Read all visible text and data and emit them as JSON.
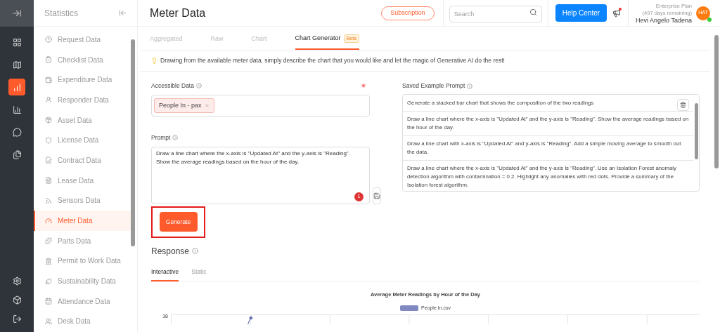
{
  "sidebar": {
    "title": "Statistics",
    "items": [
      {
        "label": "Request Data",
        "selected": false
      },
      {
        "label": "Checklist Data",
        "selected": false
      },
      {
        "label": "Expenditure Data",
        "selected": false
      },
      {
        "label": "Responder Data",
        "selected": false
      },
      {
        "label": "Asset Data",
        "selected": false
      },
      {
        "label": "License Data",
        "selected": false
      },
      {
        "label": "Contract Data",
        "selected": false
      },
      {
        "label": "Lease Data",
        "selected": false
      },
      {
        "label": "Sensors Data",
        "selected": false
      },
      {
        "label": "Meter Data",
        "selected": true
      },
      {
        "label": "Parts Data",
        "selected": false
      },
      {
        "label": "Permit to Work Data",
        "selected": false
      },
      {
        "label": "Sustainability Data",
        "selected": false
      },
      {
        "label": "Attendance Data",
        "selected": false
      },
      {
        "label": "Desk Data",
        "selected": false
      }
    ]
  },
  "rail": {
    "items": [
      {
        "selected": false
      },
      {
        "selected": false
      },
      {
        "selected": true
      },
      {
        "selected": false
      },
      {
        "selected": false
      },
      {
        "selected": false
      }
    ]
  },
  "header": {
    "title": "Meter Data",
    "subscription": "Subscription",
    "search_placeholder": "Search",
    "help": "Help Center",
    "plan": "Enterprise Plan",
    "remaining": "(497 days remaining)",
    "user": "Hevi Angelo Tadena",
    "avatar": "HAT"
  },
  "tabs": [
    {
      "label": "Aggregated",
      "selected": false
    },
    {
      "label": "Raw",
      "selected": false
    },
    {
      "label": "Chart",
      "selected": false
    },
    {
      "label": "Chart Generator",
      "selected": true,
      "badge": "Beta"
    }
  ],
  "info": "Drawing from the available meter data, simply describe the chart that you would like and let the magic of Generative AI do the rest!",
  "accessible_data": {
    "label": "Accessible Data",
    "tags": [
      "People In - pax"
    ]
  },
  "prompt": {
    "label": "Prompt",
    "value": "Draw a line chart where the x-axis is \"Updated At\" and the y-axis is \"Reading\". Show the average readings based on the hour of the day.",
    "count": "1"
  },
  "generate": "Generate",
  "saved": {
    "label": "Saved Example Prompt",
    "items": [
      "Generate a stacked bar chart that shows the composition of the two readings",
      "Draw a line chart where the x-axis is \"Updated At\" and the y-axis is \"Reading\". Show the average readings based on the hour of the day.",
      "Draw a line chart with x-axis is \"Updated At\" and y-axis is \"Reading\". Add a simple moving average to smooth out the data.",
      "Draw a line chart where the x-axis is \"Updated At\" and the y-axis is \"Reading\". Use an Isolation Forest anomaly detection algorithm with contamination = 0.2. Highlight any anomalies with red dots. Provide a summary of the Isolation forest algorithm."
    ]
  },
  "response": {
    "title": "Response",
    "tabs": [
      {
        "label": "Interactive",
        "selected": true
      },
      {
        "label": "Static",
        "selected": false
      }
    ],
    "chart": {
      "title": "Average Meter Readings by Hour of the Day",
      "legend": "People In.csv",
      "tick": "38"
    }
  }
}
